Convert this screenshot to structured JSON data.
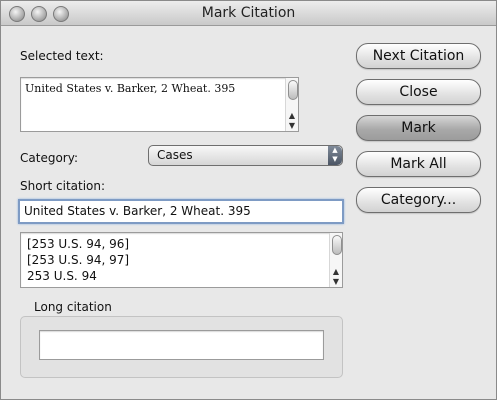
{
  "window": {
    "title": "Mark Citation"
  },
  "selected_text": {
    "label": "Selected text:",
    "value": "United States v. Barker, 2 Wheat. 395"
  },
  "category": {
    "label": "Category:",
    "selected": "Cases"
  },
  "short_citation": {
    "label": "Short citation:",
    "value": "United States v. Barker, 2 Wheat. 395"
  },
  "citation_list": {
    "items": [
      "[253 U.S. 94, 96]",
      "[253 U.S. 94, 97]",
      "253 U.S. 94"
    ]
  },
  "long_citation": {
    "label": "Long citation",
    "value": ""
  },
  "buttons": {
    "next_citation": "Next Citation",
    "close": "Close",
    "mark": "Mark",
    "mark_all": "Mark All",
    "category": "Category..."
  },
  "icons": {
    "window_controls": [
      "close-icon",
      "minimize-icon",
      "zoom-icon"
    ],
    "scroll_up": "▲",
    "scroll_down": "▼",
    "stepper": [
      "▲",
      "▼"
    ]
  }
}
